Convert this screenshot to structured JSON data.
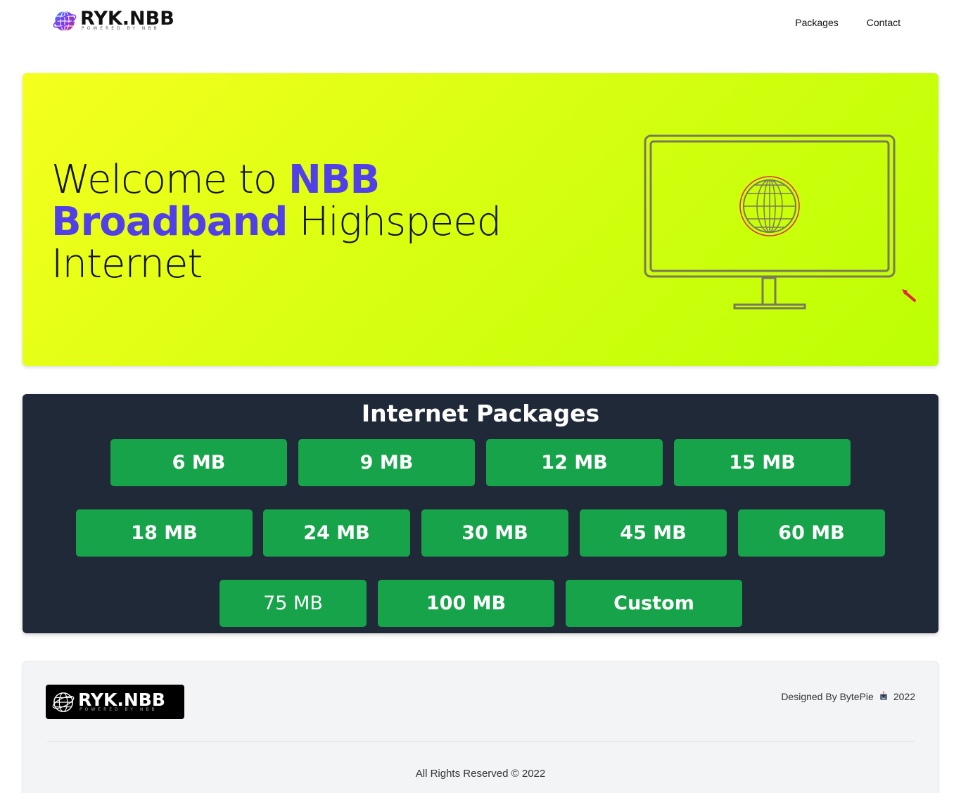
{
  "brand": {
    "name": "RYK.NBB",
    "tagline": "POWERED BY NBB"
  },
  "nav": {
    "links": [
      "Packages",
      "Contact"
    ]
  },
  "hero": {
    "title_part1": "Welcome to ",
    "title_highlight": "NBB Broadband",
    "title_part2": " Highspeed Internet",
    "accent_color": "#5140e8"
  },
  "packages": {
    "title": "Internet Packages",
    "rows": [
      [
        "6 MB",
        "9 MB",
        "12 MB",
        "15 MB"
      ],
      [
        "18 MB",
        "24 MB",
        "30 MB",
        "45 MB",
        "60 MB"
      ],
      [
        "75 MB",
        "100 MB",
        "Custom"
      ]
    ],
    "button_color": "#16a34a"
  },
  "footer": {
    "credit": "Designed By BytePie",
    "credit_year": "2022",
    "rights": "All Rights Reserved © 2022"
  }
}
